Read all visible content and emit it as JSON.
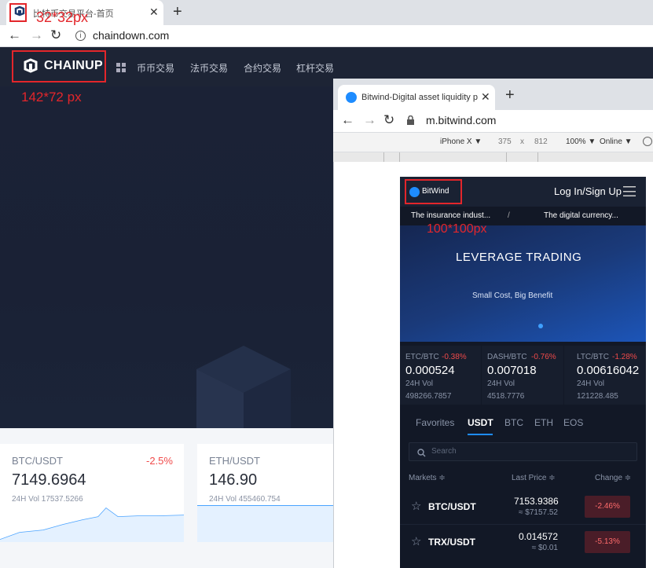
{
  "left_browser": {
    "tab_title": "比特币交易平台-首页",
    "url": "chaindown.com"
  },
  "left_site": {
    "logo": "CHAINUP",
    "nav_items": [
      "币币交易",
      "法币交易",
      "合约交易",
      "杠杆交易"
    ],
    "cards": [
      {
        "pair": "BTC/USDT",
        "change": "-2.5%",
        "price": "7149.6964",
        "vol": "24H Vol 17537.5266"
      },
      {
        "pair": "ETH/USDT",
        "price": "146.90",
        "vol": "24H Vol 455460.754"
      }
    ]
  },
  "annotations": {
    "favicon": "32*32px",
    "logo": "142*72 px",
    "mobile_logo": "100*100px"
  },
  "right_browser": {
    "tab_title": "Bitwind-Digital asset liquidity p",
    "url": "m.bitwind.com",
    "device": "iPhone X ▼",
    "width": "375",
    "times": "x",
    "height": "812",
    "zoom": "100% ▼",
    "network": "Online ▼"
  },
  "mobile": {
    "logo": "BitWind",
    "login": "Log In/Sign Up",
    "news": [
      "The insurance indust...",
      "/",
      "The digital currency..."
    ],
    "banner_title": "LEVERAGE TRADING",
    "banner_sub": "Small Cost, Big Benefit",
    "tickers": [
      {
        "pair": "ETC/BTC",
        "change": "-0.38%",
        "price": "0.000524",
        "vol_label": "24H Vol",
        "vol": "498266.7857"
      },
      {
        "pair": "DASH/BTC",
        "change": "-0.76%",
        "price": "0.007018",
        "vol_label": "24H Vol",
        "vol": "4518.7776"
      },
      {
        "pair": "LTC/BTC",
        "change": "-1.28%",
        "price": "0.00616042",
        "vol_label": "24H Vol",
        "vol": "121228.485"
      }
    ],
    "tabs": [
      "Favorites",
      "USDT",
      "BTC",
      "ETH",
      "EOS"
    ],
    "search_placeholder": "Search",
    "headers": {
      "markets": "Markets ≑",
      "last_price": "Last Price ≑",
      "change": "Change ≑"
    },
    "rows": [
      {
        "pair": "BTC/USDT",
        "price": "7153.9386",
        "sub": "≈ $7157.52",
        "change": "-2.46%"
      },
      {
        "pair": "TRX/USDT",
        "price": "0.014572",
        "sub": "≈ $0.01",
        "change": "-5.13%"
      }
    ]
  },
  "colors": {
    "red": "#e3262b",
    "accent": "#1e8cff",
    "down": "#f04a4a"
  }
}
